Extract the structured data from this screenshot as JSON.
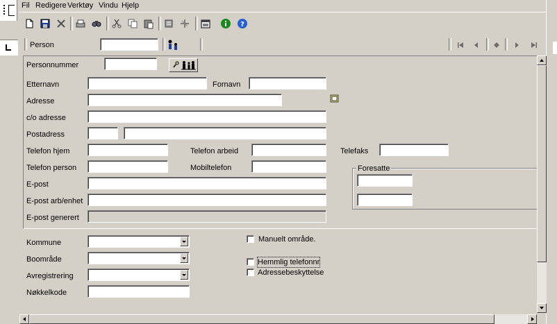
{
  "menu": {
    "items": [
      {
        "label": "Fil"
      },
      {
        "label": "Redigere"
      },
      {
        "label": "Verktøy"
      },
      {
        "label": "Vindu"
      },
      {
        "label": "Hjelp"
      }
    ]
  },
  "toolbar": {
    "icons": [
      "new-document-icon",
      "save-icon",
      "delete-icon",
      "print-icon",
      "find-icon",
      "cut-icon",
      "copy-icon",
      "paste-icon",
      "clear-icon",
      "insert-record-icon",
      "properties-icon",
      "info-icon",
      "help-icon"
    ]
  },
  "header": {
    "person_label": "Person",
    "person_value": ""
  },
  "form": {
    "personnummer_label": "Personnummer",
    "personnummer_value": "",
    "etternavn_label": "Etternavn",
    "etternavn_value": "",
    "fornavn_label": "Fornavn",
    "fornavn_value": "",
    "adresse_label": "Adresse",
    "adresse_value": "",
    "co_label": "c/o adresse",
    "co_value": "",
    "postadress_label": "Postadress",
    "postnr_value": "",
    "poststed_value": "",
    "tlf_hjem_label": "Telefon hjem",
    "tlf_hjem_value": "",
    "tlf_arbeid_label": "Telefon arbeid",
    "tlf_arbeid_value": "",
    "telefaks_label": "Telefaks",
    "telefaks_value": "",
    "tlf_person_label": "Telefon person",
    "tlf_person_value": "",
    "mobil_label": "Mobiltelefon",
    "mobil_value": "",
    "epost_label": "E-post",
    "epost_value": "",
    "epost_arb_label": "E-post arb/enhet",
    "epost_arb_value": "",
    "epost_gen_label": "E-post generert",
    "epost_gen_value": "",
    "foresatte_label": "Foresatte",
    "foresatte1_value": "",
    "foresatte2_value": ""
  },
  "lower": {
    "kommune_label": "Kommune",
    "kommune_value": "",
    "boomrade_label": "Boområde",
    "boomrade_value": "",
    "avreg_label": "Avregistrering",
    "avreg_value": "",
    "nokkel_label": "Nøkkelkode",
    "nokkel_value": "",
    "manuelt_label": "Manuelt område.",
    "hemmelig_label": "Hemmlig telefonnr",
    "adressebesk_label": "Adressebeskyttelse"
  }
}
